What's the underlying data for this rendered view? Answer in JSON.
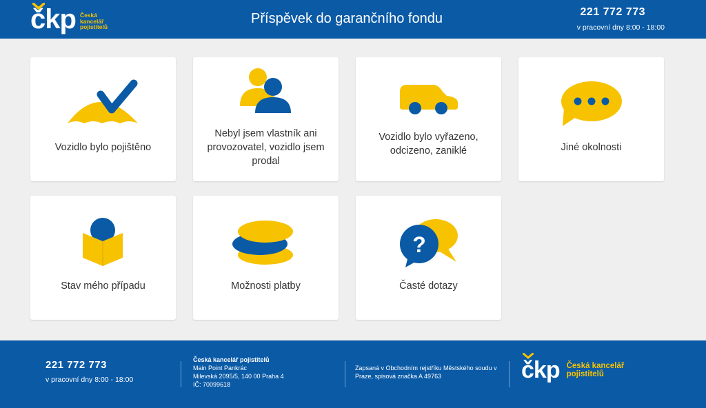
{
  "brand": {
    "mark": "čkp",
    "name_lines": [
      "Česká",
      "kancelář",
      "pojistitelů"
    ],
    "footer_name_lines": [
      "Česká kancelář",
      "pojistitelů"
    ]
  },
  "header": {
    "title": "Příspěvek do garančního fondu",
    "phone": "221 772 773",
    "hours": "v pracovní dny 8:00 - 18:00"
  },
  "tiles": [
    {
      "label": "Vozidlo bylo pojištěno",
      "icon": "umbrella-check-icon"
    },
    {
      "label": "Nebyl jsem vlastník ani provozovatel, vozidlo jsem prodal",
      "icon": "users-icon"
    },
    {
      "label": "Vozidlo bylo vyřazeno, odcizeno, zaniklé",
      "icon": "car-icon"
    },
    {
      "label": "Jiné okolnosti",
      "icon": "chat-bubble-icon"
    },
    {
      "label": "Stav mého případu",
      "icon": "reading-person-icon"
    },
    {
      "label": "Možnosti platby",
      "icon": "coins-icon"
    },
    {
      "label": "Časté dotazy",
      "icon": "question-bubbles-icon"
    }
  ],
  "footer": {
    "phone": "221 772 773",
    "hours": "v pracovní dny 8:00 - 18:00",
    "company": {
      "name": "Česká kancelář pojistitelů",
      "lines": [
        "Main Point Pankrác",
        "Milevská 2095/5, 140 00 Praha 4",
        "IČ: 70099618"
      ]
    },
    "register": "Zapsaná v Obchodním rejstříku Městského soudu v Praze, spisová značka A 49763"
  },
  "colors": {
    "primary": "#0a5aa6",
    "accent": "#f7c200",
    "background": "#efefef"
  }
}
